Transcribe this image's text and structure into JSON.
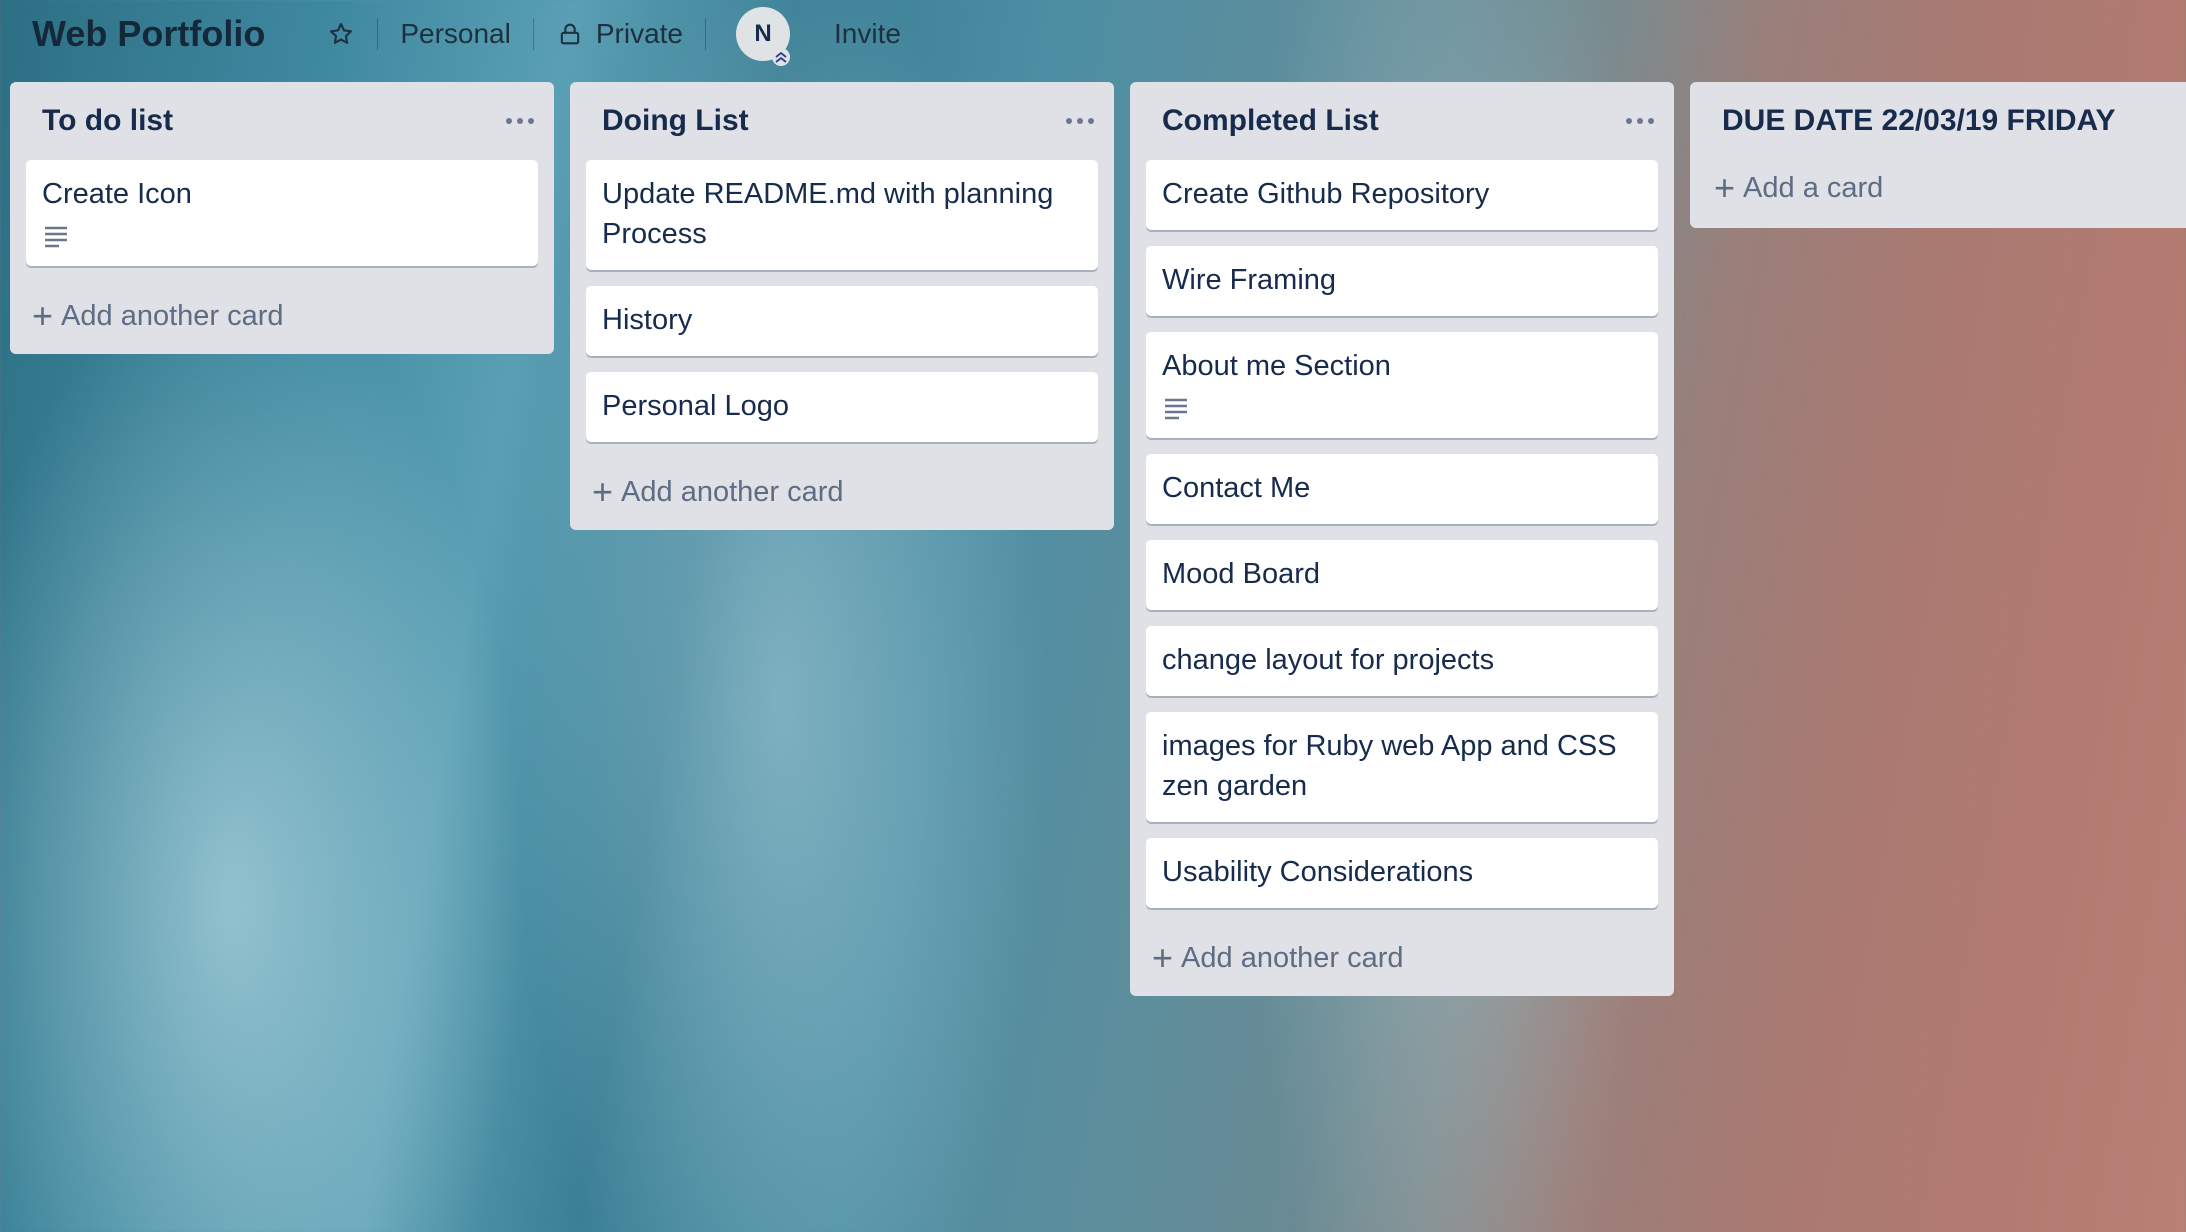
{
  "board": {
    "title": "Web Portfolio",
    "visibility_team": "Personal",
    "visibility": "Private",
    "member_initial": "N",
    "invite_label": "Invite"
  },
  "lists": [
    {
      "title": "To do list",
      "cards": [
        {
          "text": "Create Icon",
          "has_description": true
        }
      ],
      "add_label": "Add another card"
    },
    {
      "title": "Doing List",
      "cards": [
        {
          "text": "Update README.md with planning Process",
          "has_description": false
        },
        {
          "text": "History",
          "has_description": false
        },
        {
          "text": "Personal Logo",
          "has_description": false
        }
      ],
      "add_label": "Add another card"
    },
    {
      "title": "Completed List",
      "cards": [
        {
          "text": "Create Github Repository",
          "has_description": false
        },
        {
          "text": "Wire Framing",
          "has_description": false
        },
        {
          "text": "About me Section",
          "has_description": true
        },
        {
          "text": "Contact Me",
          "has_description": false
        },
        {
          "text": "Mood Board",
          "has_description": false
        },
        {
          "text": "change layout for projects",
          "has_description": false
        },
        {
          "text": "images for Ruby web App and CSS zen garden",
          "has_description": false
        },
        {
          "text": "Usability Considerations",
          "has_description": false
        }
      ],
      "add_label": "Add another card"
    },
    {
      "title": "DUE DATE 22/03/19 FRIDAY",
      "cards": [],
      "add_label": "Add a card"
    }
  ]
}
